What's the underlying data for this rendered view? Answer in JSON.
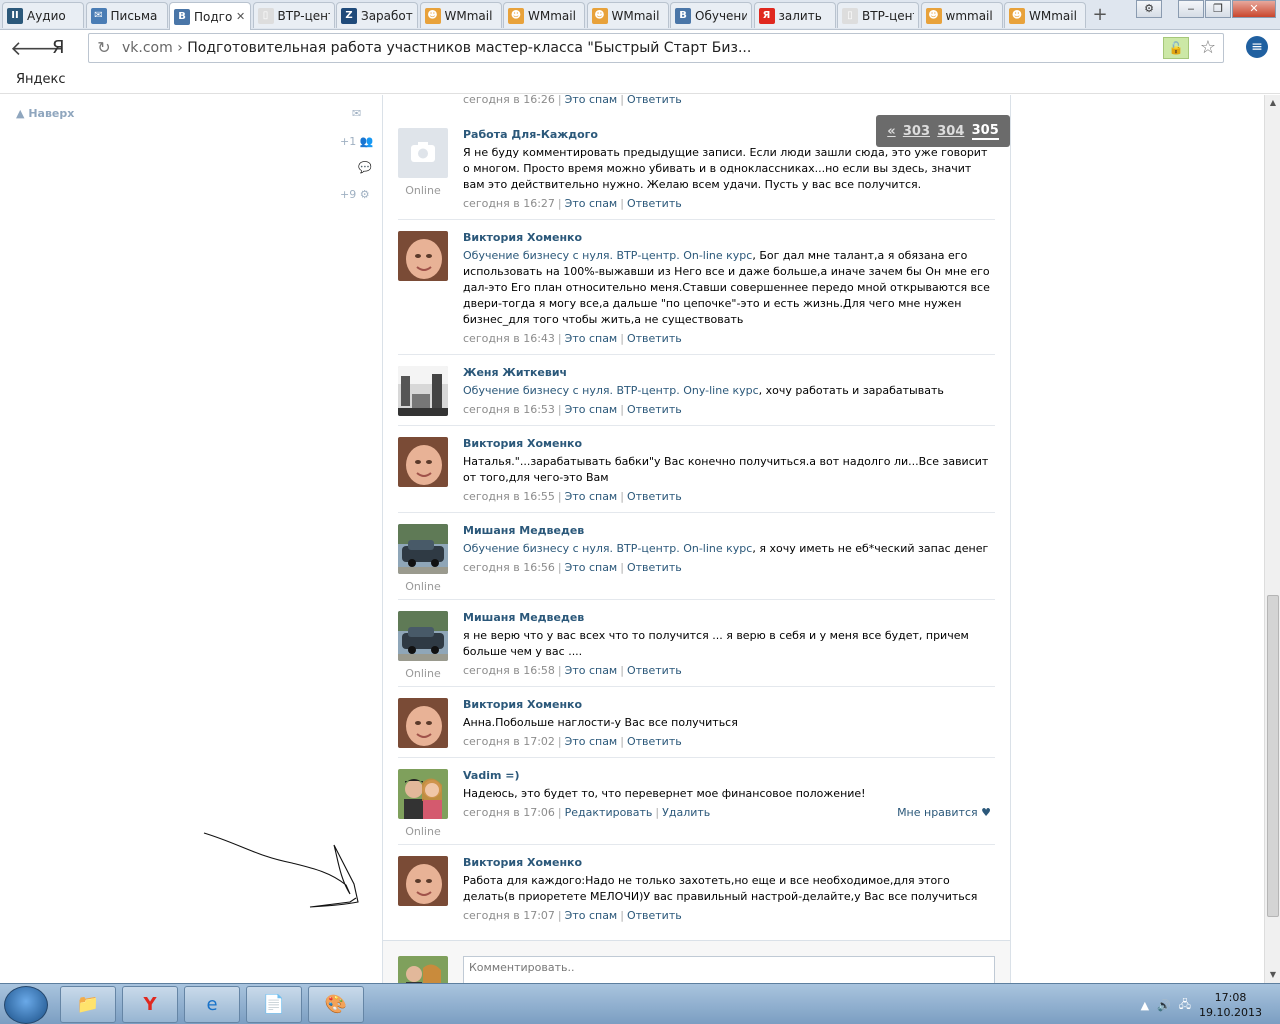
{
  "browser": {
    "tabs": [
      {
        "title": "Аудио",
        "icon": "pause-icon",
        "color": "#2b587a",
        "glyph": "II"
      },
      {
        "title": "Письма",
        "icon": "mail-icon",
        "color": "#4a7db5",
        "glyph": "✉"
      },
      {
        "title": "Подготовит",
        "icon": "vk-icon",
        "color": "#4a76a8",
        "glyph": "В",
        "active": true
      },
      {
        "title": "ВТР-центр",
        "icon": "page-icon",
        "color": "#dddddd",
        "glyph": "▯"
      },
      {
        "title": "Заработок",
        "icon": "zona-icon",
        "color": "#1f4a7a",
        "glyph": "Z"
      },
      {
        "title": "WMmail",
        "icon": "wm-icon",
        "color": "#e8a23b",
        "glyph": "☻"
      },
      {
        "title": "WMmail",
        "icon": "wm-icon",
        "color": "#e8a23b",
        "glyph": "☻"
      },
      {
        "title": "WMmail",
        "icon": "wm-icon",
        "color": "#e8a23b",
        "glyph": "☻"
      },
      {
        "title": "Обучение",
        "icon": "vk-icon",
        "color": "#4a76a8",
        "glyph": "В"
      },
      {
        "title": "залить",
        "icon": "yandex-icon",
        "color": "#e0281f",
        "glyph": "Я"
      },
      {
        "title": "ВТР-центр",
        "icon": "page-icon",
        "color": "#dddddd",
        "glyph": "▯"
      },
      {
        "title": "wmmail",
        "icon": "wm-icon",
        "color": "#e8a23b",
        "glyph": "☻"
      },
      {
        "title": "WMmail",
        "icon": "wm-icon",
        "color": "#e8a23b",
        "glyph": "☻"
      }
    ],
    "url_host": "vk.com",
    "url_sep": "›",
    "url_title": "Подготовительная работа участников мастер-класса \"Быстрый Старт Биз...",
    "bookmark_yandex": "Яндекс",
    "back_glyph": "🡐",
    "ya_glyph": "Я"
  },
  "sidebar": {
    "to_top": "Наверх",
    "count_1": "+1",
    "count_2": "+9"
  },
  "pager": {
    "prev": "«",
    "pages": [
      "303",
      "304"
    ],
    "current": "305"
  },
  "first_meta": {
    "time": "сегодня в 16:26",
    "spam": "Это спам",
    "reply": "Ответить"
  },
  "replies": [
    {
      "author": "Работа Для-Каждого",
      "avatar": "camera",
      "online": "Online",
      "mention": "",
      "text": "Я не буду комментировать предыдущие записи. Если люди зашли сюда, это уже говорит о многом. Просто время можно убивать и в одноклассниках...но если вы здесь, значит вам это действительно нужно. Желаю всем удачи. Пусть у вас все получится.",
      "time": "сегодня в 16:27",
      "a1": "Это спам",
      "a2": "Ответить"
    },
    {
      "author": "Виктория Хоменко",
      "avatar": "baby",
      "online": "",
      "mention": "Обучение бизнесу с нуля. ВТР-центр. On-line курс",
      "text": ", Бог дал мне талант,а я обязана его использовать на 100%-выжавши из Него все и даже больше,а иначе зачем бы Он мне его дал-это Его план относительно меня.Ставши совершеннее передо мной открываются все двери-тогда я могу все,а дальше \"по цепочке\"-это и есть жизнь.Для чего мне нужен бизнес_для того чтобы жить,а не существовать",
      "time": "сегодня в 16:43",
      "a1": "Это спам",
      "a2": "Ответить"
    },
    {
      "author": "Женя Житкевич",
      "avatar": "bw",
      "online": "",
      "mention": "Обучение бизнесу с нуля. ВТР-центр. Ony-line курс",
      "text": ", хочу работать и зарабатывать",
      "time": "сегодня в 16:53",
      "a1": "Это спам",
      "a2": "Ответить"
    },
    {
      "author": "Виктория Хоменко",
      "avatar": "baby",
      "online": "",
      "mention": "",
      "text": "Наталья.\"...зарабатывать бабки\"у Вас конечно получиться.а вот надолго ли...Все зависит от того,для чего-это Вам",
      "time": "сегодня в 16:55",
      "a1": "Это спам",
      "a2": "Ответить"
    },
    {
      "author": "Мишаня Медведев",
      "avatar": "car",
      "online": "Online",
      "mention": "Обучение бизнесу с нуля. ВТР-центр. On-line курс",
      "text": ", я хочу иметь не еб*ческий запас денег",
      "time": "сегодня в 16:56",
      "a1": "Это спам",
      "a2": "Ответить"
    },
    {
      "author": "Мишаня Медведев",
      "avatar": "car",
      "online": "Online",
      "mention": "",
      "text": "я не верю что у вас всех что то получится ... я верю в себя и у меня все будет, причем больше чем у вас ....",
      "time": "сегодня в 16:58",
      "a1": "Это спам",
      "a2": "Ответить"
    },
    {
      "author": "Виктория Хоменко",
      "avatar": "baby",
      "online": "",
      "mention": "",
      "text": "Анна.Побольше наглости-у Вас все получиться",
      "time": "сегодня в 17:02",
      "a1": "Это спам",
      "a2": "Ответить"
    },
    {
      "author": "Vadim =)",
      "avatar": "couple",
      "online": "Online",
      "mention": "",
      "text": "Надеюсь, это будет то, что перевернет мое финансовое положение!",
      "time": "сегодня в 17:06",
      "a1": "Редактировать",
      "a2": "Удалить",
      "like": "Мне нравится ♥"
    },
    {
      "author": "Виктория Хоменко",
      "avatar": "baby",
      "online": "",
      "mention": "",
      "text": "Работа для каждого:Надо не только захотеть,но еще и все необходимое,для этого делать(в приоретете МЕЛОЧИ)У вас правильный настрой-делайте,у Вас все получиться",
      "time": "сегодня в 17:07",
      "a1": "Это спам",
      "a2": "Ответить"
    }
  ],
  "compose": {
    "placeholder": "Комментировать.."
  },
  "taskbar": {
    "time": "17:08",
    "date": "19.10.2013"
  }
}
